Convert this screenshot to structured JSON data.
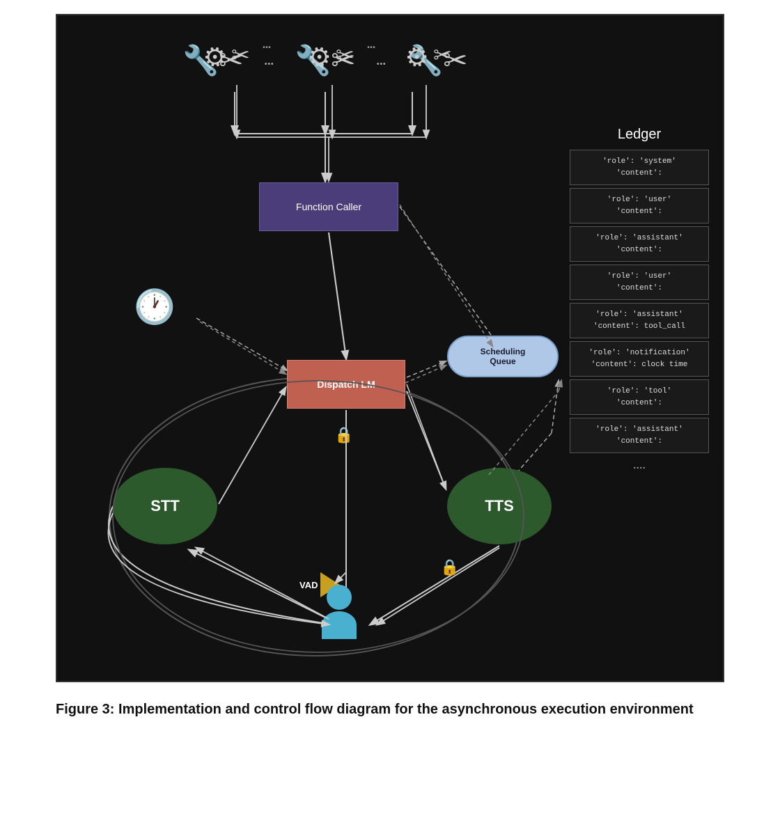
{
  "diagram": {
    "background_color": "#111",
    "tools": {
      "icons": [
        "⚒",
        "⚒",
        "⚒"
      ],
      "dots": [
        "...",
        "..."
      ]
    },
    "function_caller": {
      "label": "Function Caller"
    },
    "ledger": {
      "title": "Ledger",
      "items": [
        {
          "line1": "'role': 'system'",
          "line2": "'content':"
        },
        {
          "line1": "'role': 'user'",
          "line2": "'content':"
        },
        {
          "line1": "'role': 'assistant'",
          "line2": "'content':"
        },
        {
          "line1": "'role': 'user'",
          "line2": "'content':"
        },
        {
          "line1": "'role': 'assistant'",
          "line2": "'content': tool_call"
        },
        {
          "line1": "'role': 'notification'",
          "line2": "'content': clock time"
        },
        {
          "line1": "'role': 'tool'",
          "line2": "'content':"
        },
        {
          "line1": "'role': 'assistant'",
          "line2": "'content':"
        }
      ],
      "dots": "...."
    },
    "dispatch_lm": {
      "label": "Dispatch LM"
    },
    "scheduling_queue": {
      "label": "Scheduling\nQueue"
    },
    "stt": {
      "label": "STT"
    },
    "tts": {
      "label": "TTS"
    },
    "vad": {
      "label": "VAD"
    }
  },
  "caption": {
    "text": "Figure 3: Implementation and control flow diagram for the asynchronous execution environment"
  }
}
